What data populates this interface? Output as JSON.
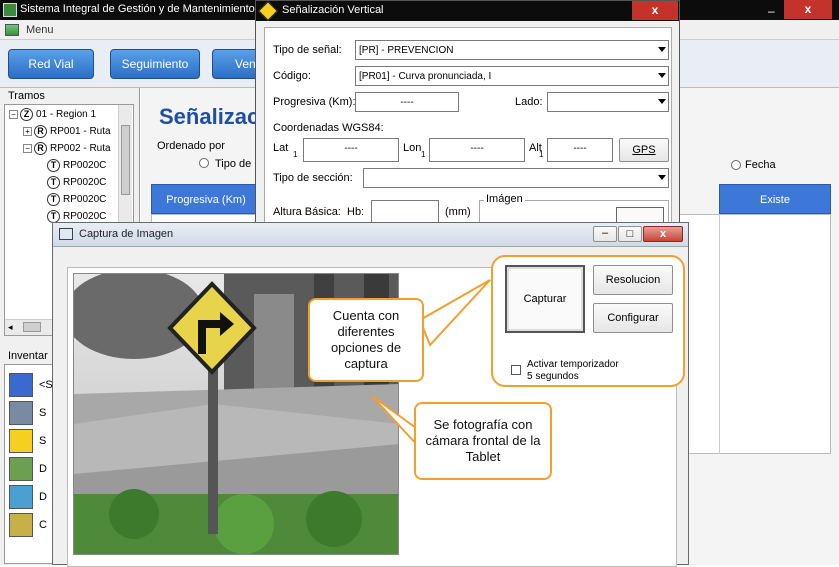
{
  "main_window": {
    "title": "Sistema Integral de Gestión y de Mantenimiento",
    "menu_label": "Menu",
    "toolbar_buttons": [
      "Red Vial",
      "Seguimiento",
      "Ven"
    ],
    "tramos_label": "Tramos",
    "tree": [
      {
        "label": "01 - Region 1",
        "badge": "Z",
        "sign": "−"
      },
      {
        "label": "RP001 - Ruta",
        "badge": "R",
        "sign": "+"
      },
      {
        "label": "RP002 - Ruta",
        "badge": "R",
        "sign": "−"
      },
      {
        "label": "RP0020C",
        "badge": "T",
        "sign": ""
      },
      {
        "label": "RP0020C",
        "badge": "T",
        "sign": ""
      },
      {
        "label": "RP0020C",
        "badge": "T",
        "sign": ""
      },
      {
        "label": "RP0020C",
        "badge": "T",
        "sign": ""
      }
    ],
    "inventory_label": "Inventar",
    "inventory_items": [
      "<S",
      "S",
      "S",
      "D",
      "D",
      "C"
    ],
    "section_title": "Señalizac",
    "ordenado_por": "Ordenado por",
    "radio_tipo": "Tipo de",
    "radio_fecha": "Fecha",
    "table_headers": [
      "Progresiva (Km)",
      "Existe"
    ]
  },
  "signal_dialog": {
    "title": "Señalización Vertical",
    "close": "x",
    "tipo_label": "Tipo de señal:",
    "tipo_value": "[PR] - PREVENCION",
    "codigo_label": "Código:",
    "codigo_value": "[PR01] - Curva pronunciada, I",
    "progresiva_label": "Progresiva (Km):",
    "progresiva_value": "----",
    "lado_label": "Lado:",
    "lado_value": "",
    "coord_label": "Coordenadas WGS84:",
    "lat_label": "Lat",
    "lat_value": "----",
    "lon_label": "Lon",
    "lon_value": "----",
    "alt_label": "Alt",
    "alt_value": "----",
    "sub": "1",
    "gps_label": "GPS",
    "seccion_label": "Tipo de sección:",
    "seccion_value": "",
    "altura_label": "Altura Básica:",
    "hb_label": "Hb:",
    "hb_value": "",
    "mm_label": "(mm)",
    "imagen_label": "Imágen"
  },
  "capture_dialog": {
    "title": "Captura de Imagen",
    "capturar": "Capturar",
    "resolucion": "Resolucion",
    "configurar": "Configurar",
    "timer_line1": "Activar temporizador",
    "timer_line2": "5 segundos"
  },
  "callouts": {
    "capture_options": "Cuenta con diferentes opciones de captura",
    "front_camera": "Se fotografía con cámara frontal de la Tablet"
  },
  "colors": {
    "title_bar": "#0c0c0c",
    "button_blue": "#2b6fc6",
    "table_header": "#3d78d8",
    "callout_border": "#f0a030",
    "close_red": "#c4332b"
  }
}
